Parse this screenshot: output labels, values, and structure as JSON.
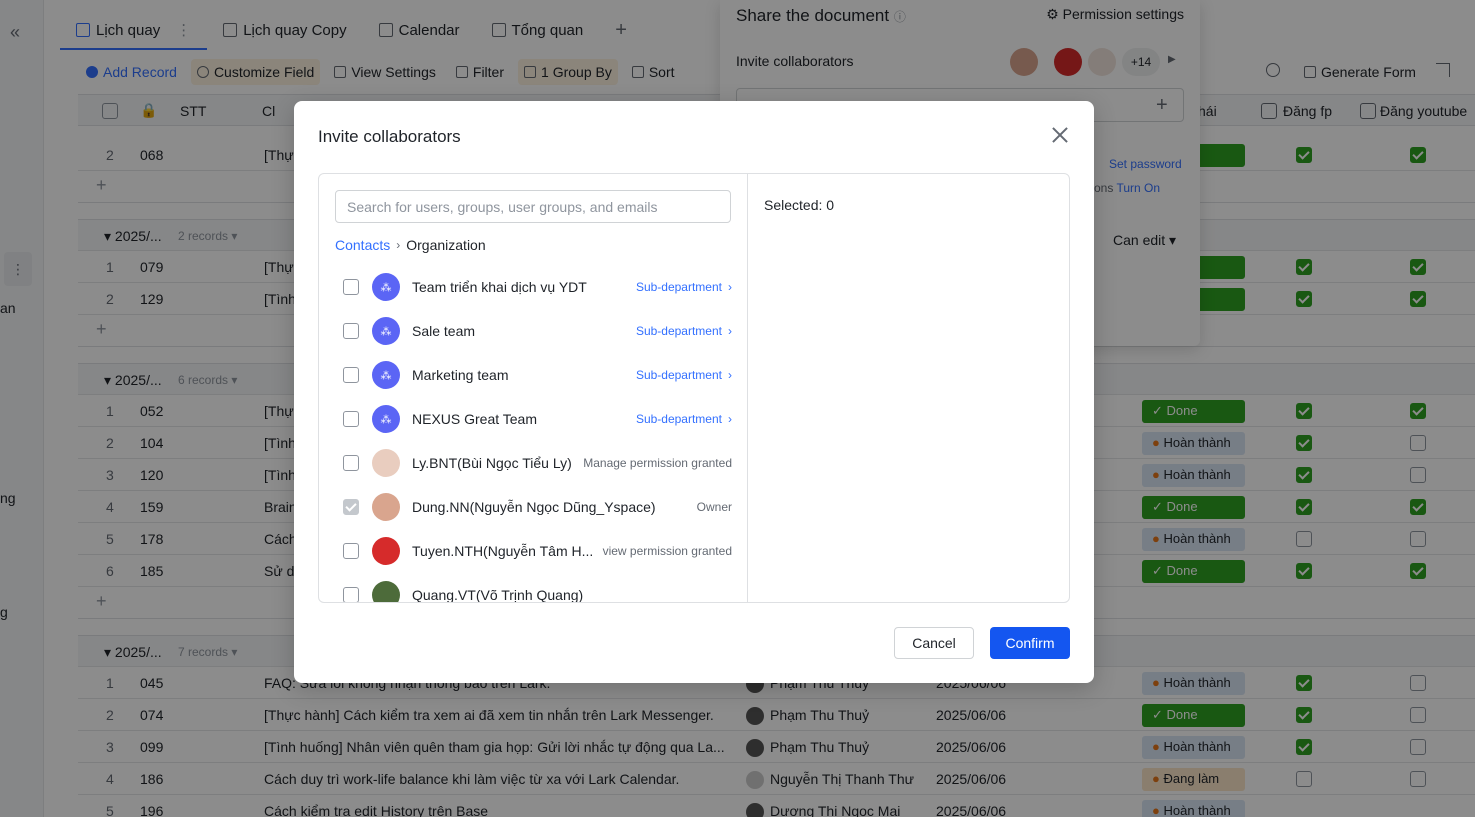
{
  "tabs": [
    {
      "label": "Lịch quay"
    },
    {
      "label": "Lịch quay Copy"
    },
    {
      "label": "Calendar"
    },
    {
      "label": "Tổng quan"
    }
  ],
  "toolbar": {
    "add_record": "Add Record",
    "customize_field": "Customize Field",
    "view_settings": "View Settings",
    "filter": "Filter",
    "group_by": "1 Group By",
    "sort": "Sort",
    "generate_form": "Generate Form"
  },
  "grid_header": {
    "stt": "STT",
    "col_c": "Cl",
    "status": "hái",
    "fp": "Đăng fp",
    "youtube": "Đăng youtube"
  },
  "rail": {
    "a": "an",
    "b": "ng",
    "c": "g"
  },
  "share_panel": {
    "title": "Share the document",
    "permission_settings": "Permission settings",
    "invite_label": "Invite collaborators",
    "more_count": "+14",
    "set_password": "Set password",
    "turn_on_prefix": "ons",
    "turn_on": "Turn On",
    "can_edit": "Can edit"
  },
  "groups": [
    {
      "label": "2025/...",
      "count": "2 records"
    },
    {
      "label": "2025/...",
      "count": "6 records"
    },
    {
      "label": "2025/...",
      "count": "7 records"
    }
  ],
  "rows": {
    "r0": {
      "num": "2",
      "stt": "068",
      "title": "[Thự"
    },
    "g1": [
      {
        "num": "1",
        "stt": "079",
        "title": "[Thự"
      },
      {
        "num": "2",
        "stt": "129",
        "title": "[Tình"
      }
    ],
    "g2": [
      {
        "num": "1",
        "stt": "052",
        "title": "[Thự",
        "status": "Done"
      },
      {
        "num": "2",
        "stt": "104",
        "title": "[Tình",
        "status": "Hoàn thành"
      },
      {
        "num": "3",
        "stt": "120",
        "title": "[Tình",
        "status": "Hoàn thành"
      },
      {
        "num": "4",
        "stt": "159",
        "title": "Brain",
        "status": "Done"
      },
      {
        "num": "5",
        "stt": "178",
        "title": "Cách",
        "status": "Hoàn thành"
      },
      {
        "num": "6",
        "stt": "185",
        "title": "Sử d",
        "status": "Done"
      }
    ],
    "g3": [
      {
        "num": "1",
        "stt": "045",
        "title": "FAQ: Sửa lỗi không nhận thông báo trên Lark.",
        "person": "Phạm Thu Thuỷ",
        "date": "2025/06/06",
        "status": "Hoàn thành"
      },
      {
        "num": "2",
        "stt": "074",
        "title": "[Thực hành] Cách kiểm tra xem ai đã xem tin nhắn trên Lark Messenger.",
        "person": "Phạm Thu Thuỷ",
        "date": "2025/06/06",
        "status": "Done"
      },
      {
        "num": "3",
        "stt": "099",
        "title": "[Tình huống] Nhân viên quên tham gia họp: Gửi lời nhắc tự động qua La...",
        "person": "Phạm Thu Thuỷ",
        "date": "2025/06/06",
        "status": "Hoàn thành"
      },
      {
        "num": "4",
        "stt": "186",
        "title": "Cách duy trì work-life balance khi làm việc từ xa với Lark Calendar.",
        "person": "Nguyễn Thị Thanh Thư",
        "date": "2025/06/06",
        "status": "Đang làm"
      },
      {
        "num": "5",
        "stt": "196",
        "title": "Cách kiểm tra edit History trên Base",
        "person": "Dương Thị Ngọc Mai",
        "date": "2025/06/06",
        "status": "Hoàn thành"
      }
    ]
  },
  "modal": {
    "title": "Invite collaborators",
    "search_placeholder": "Search for users, groups, user groups, and emails",
    "crumb_contacts": "Contacts",
    "crumb_org": "Organization",
    "selected": "Selected: 0",
    "cancel": "Cancel",
    "confirm": "Confirm",
    "items": [
      {
        "name": "Team triển khai dịch vụ YDT",
        "tag": "Sub-department"
      },
      {
        "name": "Sale team",
        "tag": "Sub-department"
      },
      {
        "name": "Marketing team",
        "tag": "Sub-department"
      },
      {
        "name": "NEXUS Great Team",
        "tag": "Sub-department"
      },
      {
        "name": "Ly.BNT(Bùi Ngọc Tiểu Ly)",
        "tag": "Manage permission granted"
      },
      {
        "name": "Dung.NN(Nguyễn Ngọc Dũng_Yspace)",
        "tag": "Owner"
      },
      {
        "name": "Tuyen.NTH(Nguyễn Tâm H...",
        "tag": "view permission granted"
      },
      {
        "name": "Quang.VT(Võ Trịnh Quang)",
        "tag": ""
      }
    ]
  }
}
